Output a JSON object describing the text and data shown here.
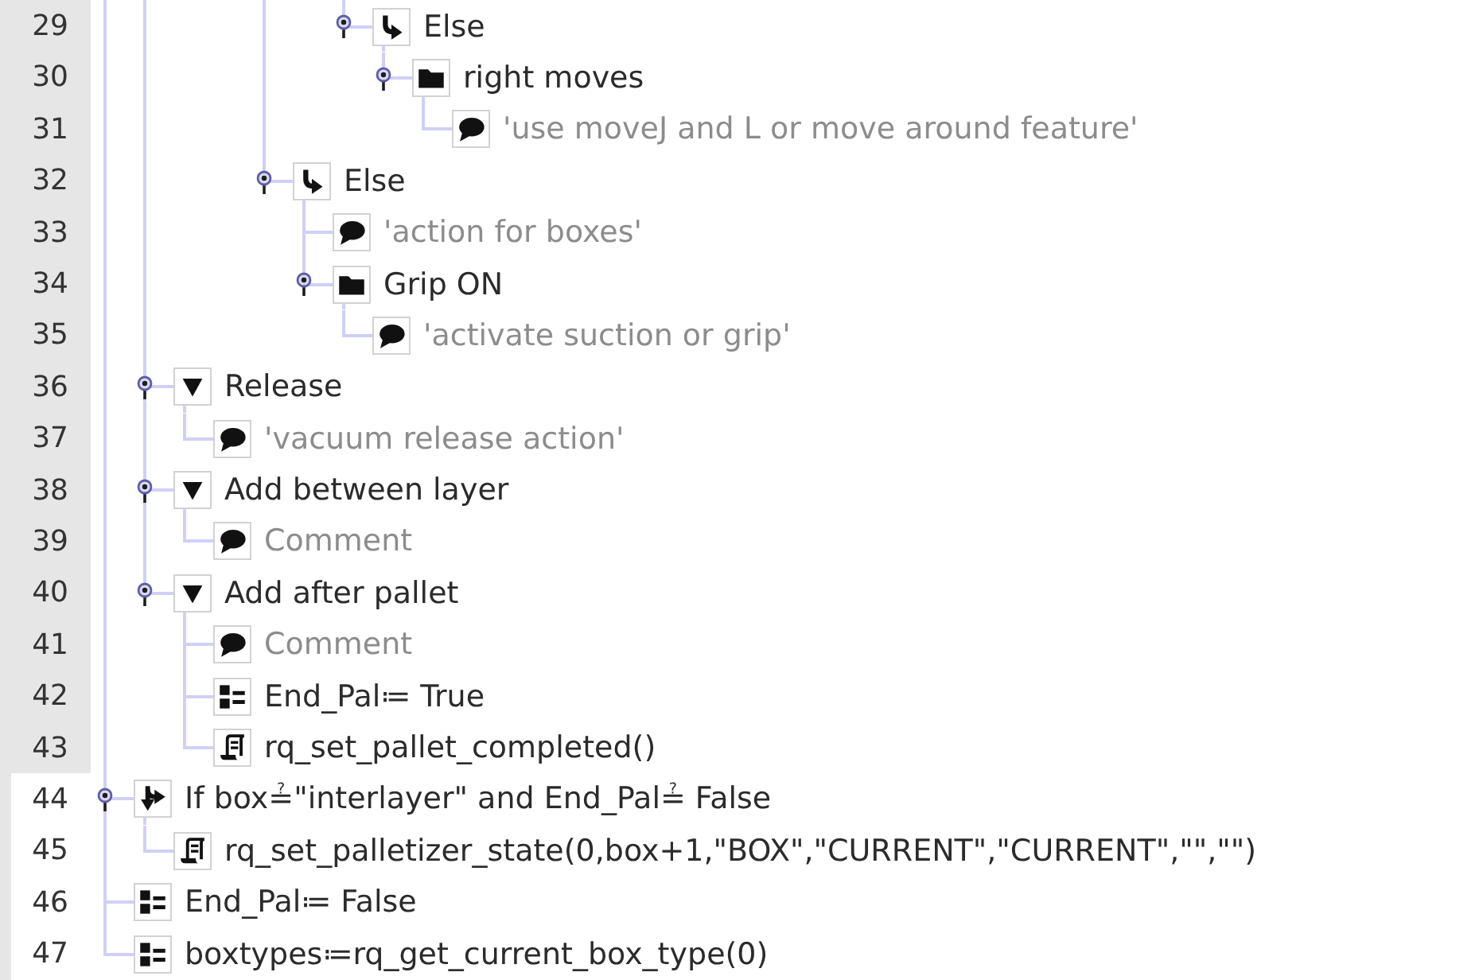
{
  "gutter": {
    "lines": [
      {
        "number": "29",
        "highlighted": true
      },
      {
        "number": "30",
        "highlighted": true
      },
      {
        "number": "31",
        "highlighted": true
      },
      {
        "number": "32",
        "highlighted": true
      },
      {
        "number": "33",
        "highlighted": true
      },
      {
        "number": "34",
        "highlighted": true
      },
      {
        "number": "35",
        "highlighted": true
      },
      {
        "number": "36",
        "highlighted": true
      },
      {
        "number": "37",
        "highlighted": true
      },
      {
        "number": "38",
        "highlighted": true
      },
      {
        "number": "39",
        "highlighted": true
      },
      {
        "number": "40",
        "highlighted": true
      },
      {
        "number": "41",
        "highlighted": true
      },
      {
        "number": "42",
        "highlighted": true
      },
      {
        "number": "43",
        "highlighted": true
      },
      {
        "number": "44",
        "highlighted": false
      },
      {
        "number": "45",
        "highlighted": false
      },
      {
        "number": "46",
        "highlighted": false
      },
      {
        "number": "47",
        "highlighted": false
      }
    ]
  },
  "tree": {
    "nodes": [
      {
        "children": [
          {
            "children": [
              {
                "children": [
                  {
                    "children": [
                      {
                        "children": [
                          {
                            "children": [
                              {
                                "kind": "else",
                                "label": "Else",
                                "children": [
                                  {
                                    "kind": "folder",
                                    "label": "right moves",
                                    "children": [
                                      {
                                        "kind": "comment",
                                        "label": "'use moveJ and L or move around feature'"
                                      }
                                    ]
                                  }
                                ]
                              }
                            ]
                          }
                        ]
                      },
                      {
                        "kind": "else",
                        "label": "Else",
                        "children": [
                          {
                            "kind": "comment",
                            "label": "'action for boxes'"
                          },
                          {
                            "kind": "folder",
                            "label": "Grip ON",
                            "children": [
                              {
                                "kind": "comment",
                                "label": "'activate suction or grip'"
                              }
                            ]
                          }
                        ]
                      }
                    ]
                  }
                ]
              }
            ]
          },
          {
            "kind": "section",
            "label": "Release",
            "children": [
              {
                "kind": "comment",
                "label": "'vacuum release action'"
              }
            ]
          },
          {
            "kind": "section",
            "label": "Add between layer",
            "children": [
              {
                "kind": "comment",
                "label": "Comment"
              }
            ]
          },
          {
            "kind": "section",
            "label": "Add after pallet",
            "children": [
              {
                "kind": "comment",
                "label": "Comment"
              },
              {
                "kind": "assignment",
                "label": "End_Pal≔ True"
              },
              {
                "kind": "script",
                "label": "rq_set_pallet_completed()"
              }
            ]
          }
        ]
      },
      {
        "kind": "if",
        "label": "If box≟\"interlayer\" and End_Pal≟ False",
        "children": [
          {
            "kind": "script",
            "label": "rq_set_palletizer_state(0,box+1,\"BOX\",\"CURRENT\",\"CURRENT\",\"\",\"\")"
          }
        ]
      },
      {
        "kind": "assignment",
        "label": "End_Pal≔ False"
      },
      {
        "kind": "assignment",
        "label": "boxtypes≔rq_get_current_box_type(0)"
      }
    ]
  }
}
